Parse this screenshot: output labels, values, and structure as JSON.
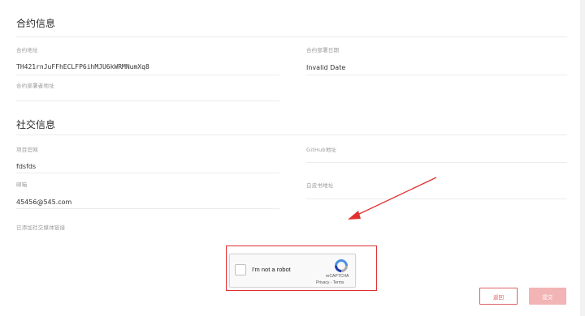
{
  "contract_info": {
    "title": "合约信息",
    "address_label": "合约地址",
    "address_value": "TH421rnJuFFhECLFP6ihMJU6kWRMNumXq8",
    "deploy_date_label": "合约部署日期",
    "deploy_date_value": "Invalid Date",
    "deployer_label": "合约部署者地址"
  },
  "social_info": {
    "title": "社交信息",
    "website_label": "项目官网",
    "website_value": "fdsfds",
    "github_label": "GitHub地址",
    "email_label": "邮箱",
    "email_value": "45456@545.com",
    "whitepaper_label": "白皮书地址",
    "added_media_label": "已添加社交媒体链接"
  },
  "captcha": {
    "label": "I'm not a robot",
    "brand": "reCAPTCHA",
    "privacy": "Privacy",
    "separator": " - ",
    "terms": "Terms"
  },
  "actions": {
    "back_label": "返回",
    "submit_label": "提交"
  },
  "colors": {
    "annotation_red": "#e03030",
    "button_accent": "#e06060",
    "submit_disabled": "#f2b4b4"
  }
}
